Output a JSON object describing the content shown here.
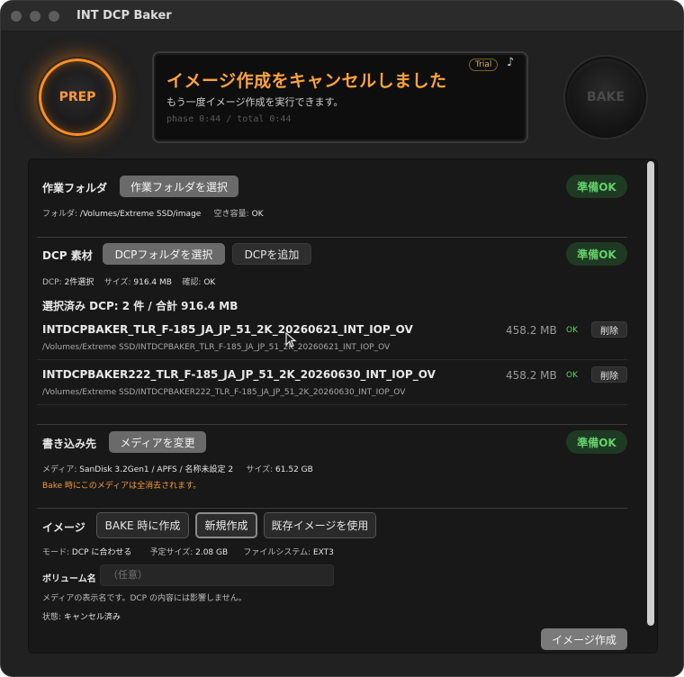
{
  "window": {
    "title": "INT DCP Baker"
  },
  "knobs": {
    "prep": "PREP",
    "bake": "BAKE"
  },
  "status": {
    "title": "イメージ作成をキャンセルしました",
    "subtitle": "もう一度イメージ作成を実行できます。",
    "phase": "phase 0:44 / total 0:44",
    "badge": "Trial",
    "music_icon": "♪"
  },
  "work": {
    "label": "作業フォルダ",
    "select_button": "作業フォルダを選択",
    "status": "準備OK",
    "folder_label": "フォルダ:",
    "folder_value": "/Volumes/Extreme SSD/image",
    "space_label": "空き容量:",
    "space_value": "OK"
  },
  "dcp": {
    "label": "DCP 素材",
    "select_button": "DCPフォルダを選択",
    "add_button": "DCPを追加",
    "status": "準備OK",
    "count_label": "DCP:",
    "count_value": "2件選択",
    "size_label": "サイズ:",
    "size_value": "916.4 MB",
    "check_label": "確認:",
    "check_value": "OK",
    "summary": "選択済み DCP: 2 件 / 合計 916.4 MB",
    "items": [
      {
        "name": "INTDCPBAKER_TLR_F-185_JA_JP_51_2K_20260621_INT_IOP_OV",
        "path": "/Volumes/Extreme SSD/INTDCPBAKER_TLR_F-185_JA_JP_51_2K_20260621_INT_IOP_OV",
        "size": "458.2 MB",
        "status": "OK",
        "delete": "削除"
      },
      {
        "name": "INTDCPBAKER222_TLR_F-185_JA_JP_51_2K_20260630_INT_IOP_OV",
        "path": "/Volumes/Extreme SSD/INTDCPBAKER222_TLR_F-185_JA_JP_51_2K_20260630_INT_IOP_OV",
        "size": "458.2 MB",
        "status": "OK",
        "delete": "削除"
      }
    ]
  },
  "dest": {
    "label": "書き込み先",
    "change_button": "メディアを変更",
    "status": "準備OK",
    "media_label": "メディア:",
    "media_value": "SanDisk 3.2Gen1 / APFS / 名称未設定 2",
    "size_label": "サイズ:",
    "size_value": "61.52 GB",
    "warning": "Bake 時にこのメディアは全消去されます。"
  },
  "image": {
    "label": "イメージ",
    "opt_bake": "BAKE 時に作成",
    "opt_new": "新規作成",
    "opt_existing": "既存イメージを使用",
    "mode_label": "モード:",
    "mode_value": "DCP に合わせる",
    "est_label": "予定サイズ:",
    "est_value": "2.08 GB",
    "fs_label": "ファイルシステム:",
    "fs_value": "EXT3",
    "volume_label": "ボリューム名",
    "volume_placeholder": "（任意）",
    "volume_note": "メディアの表示名です。DCP の内容には影響しません。",
    "state_label": "状態:",
    "state_value": "キャンセル済み",
    "create_button": "イメージ作成"
  }
}
